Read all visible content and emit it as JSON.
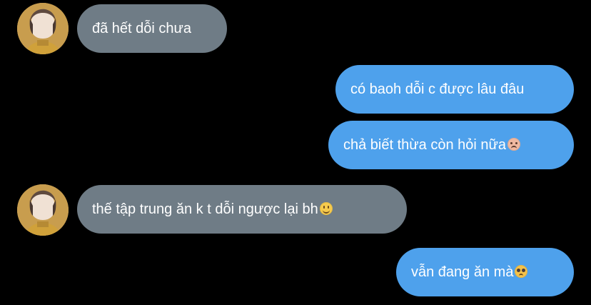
{
  "messages": [
    {
      "side": "incoming",
      "text": "đã hết dỗi chưa",
      "emoji": "",
      "avatar": true
    },
    {
      "side": "outgoing",
      "text": "có baoh dỗi c được lâu đâu",
      "emoji": "",
      "avatar": false
    },
    {
      "side": "outgoing",
      "text": "chả biết thừa còn hỏi nữa",
      "emoji": "angry-face-emoji",
      "avatar": false
    },
    {
      "side": "incoming",
      "text": "thế tập trung ăn k t dỗi ngược lại bh",
      "emoji": "slightly-smiling-face-emoji",
      "avatar": true
    },
    {
      "side": "outgoing",
      "text": "vẫn đang ăn mà",
      "emoji": "pleading-face-emoji",
      "avatar": false
    }
  ],
  "colors": {
    "background": "#000000",
    "incoming_bubble": "#6f7c86",
    "outgoing_bubble": "#4ea1ec",
    "text": "#ffffff"
  },
  "icons": {
    "avatar": "profile-avatar",
    "angry": "angry-face-emoji",
    "smile": "slightly-smiling-face-emoji",
    "pleading": "pleading-face-emoji"
  }
}
